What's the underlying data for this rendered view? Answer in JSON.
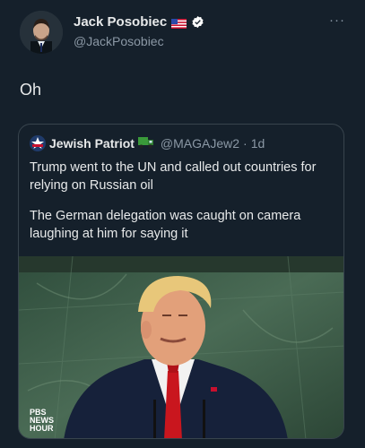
{
  "author": {
    "display_name": "Jack Posobiec",
    "handle": "@JackPosobiec",
    "flag_icon": "us-flag-icon",
    "verified_icon": "verified-badge-icon",
    "more_label": "···"
  },
  "tweet": {
    "text": "Oh"
  },
  "quoted": {
    "display_name": "Jewish Patriot",
    "handle": "@MAGAJew2",
    "separator": "·",
    "time": "1d",
    "paragraphs": [
      "Trump went to the UN and called out countries for relying on Russian oil",
      "The German delegation was caught on camera laughing at him for saying it"
    ],
    "media": {
      "watermark_line1": "PBS",
      "watermark_line2": "NEWS",
      "watermark_line3": "HOUR"
    }
  },
  "colors": {
    "background": "#15202b",
    "text_primary": "#e7e9ea",
    "text_secondary": "#8b98a5",
    "verified": "#ffffff",
    "border": "#38444d"
  }
}
